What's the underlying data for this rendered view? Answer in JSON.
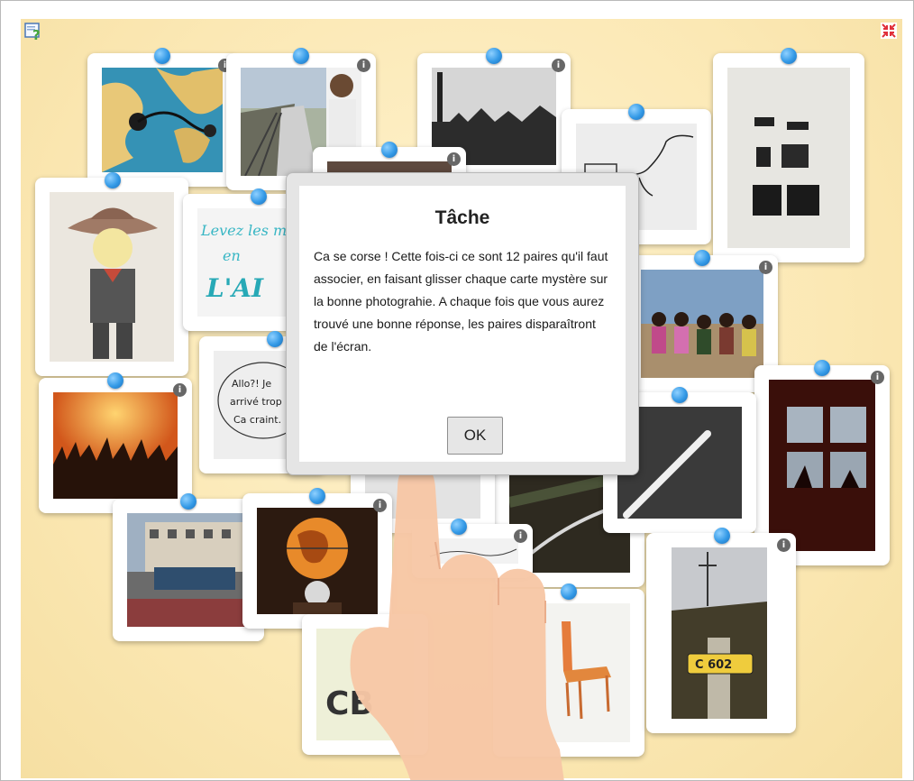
{
  "toolbar": {
    "help_icon": "help-question-icon",
    "fullscreen_icon": "fullscreen-exit-icon"
  },
  "cards": {
    "info_glyph": "i",
    "pin_color": "#3399e6",
    "photo_captions": {
      "wall_handwriting_1": "Levez les m en L'AI",
      "note_handwriting": "Allo?! Je arrivé trop Ca craint.",
      "sign_plate": "C 602"
    }
  },
  "dialog": {
    "title": "Tâche",
    "body": "Ca se corse ! Cette fois-ci ce sont 12 paires qu'il faut associer, en faisant glisser chaque carte mystère sur la bonne photograhie. A chaque fois que vous aurez trouvé une bonne réponse, les paires disparaîtront de l'écran.",
    "ok_label": "OK"
  },
  "colors": {
    "board_background": "#fbe8b4",
    "pin_blue": "#3399e6",
    "dialog_frame": "#e5e5e5"
  }
}
